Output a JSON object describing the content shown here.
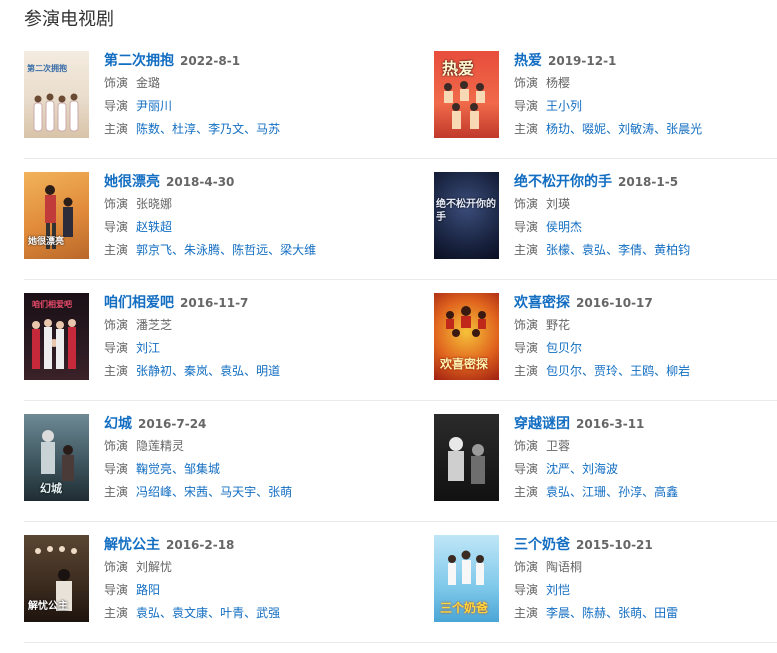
{
  "page_title": "参演电视剧",
  "labels": {
    "role": "饰演",
    "director": "导演",
    "cast": "主演"
  },
  "shows": [
    {
      "title": "第二次拥抱",
      "date": "2022-8-1",
      "role": "金璐",
      "director": "尹丽川",
      "cast": [
        "陈数",
        "杜淳",
        "李乃文",
        "马苏"
      ],
      "poster_text": "第二次拥抱"
    },
    {
      "title": "热爱",
      "date": "2019-12-1",
      "role": "杨樱",
      "director": "王小列",
      "cast": [
        "杨玏",
        "啜妮",
        "刘敏涛",
        "张晨光"
      ],
      "poster_text": "热爱"
    },
    {
      "title": "她很漂亮",
      "date": "2018-4-30",
      "role": "张晓娜",
      "director": "赵轶超",
      "cast": [
        "郭京飞",
        "朱泳腾",
        "陈哲远",
        "梁大维"
      ],
      "poster_text": "她很漂亮"
    },
    {
      "title": "绝不松开你的手",
      "date": "2018-1-5",
      "role": "刘瑛",
      "director": "侯明杰",
      "cast": [
        "张檬",
        "袁弘",
        "李倩",
        "黄柏钧"
      ],
      "poster_text": "绝不松开你的手"
    },
    {
      "title": "咱们相爱吧",
      "date": "2016-11-7",
      "role": "潘芝芝",
      "director": "刘江",
      "cast": [
        "张静初",
        "秦岚",
        "袁弘",
        "明道"
      ],
      "poster_text": "咱们相爱吧"
    },
    {
      "title": "欢喜密探",
      "date": "2016-10-17",
      "role": "野花",
      "director": "包贝尔",
      "cast": [
        "包贝尔",
        "贾玲",
        "王鸥",
        "柳岩"
      ],
      "poster_text": "欢喜密探"
    },
    {
      "title": "幻城",
      "date": "2016-7-24",
      "role": "隐莲精灵",
      "director": "鞠觉亮、邹集城",
      "cast": [
        "冯绍峰",
        "宋茜",
        "马天宇",
        "张萌"
      ],
      "poster_text": "幻城"
    },
    {
      "title": "穿越谜团",
      "date": "2016-3-11",
      "role": "卫蓉",
      "director": "沈严、刘海波",
      "cast": [
        "袁弘",
        "江珊",
        "孙淳",
        "高鑫"
      ],
      "poster_text": ""
    },
    {
      "title": "解忧公主",
      "date": "2016-2-18",
      "role": "刘解忧",
      "director": "路阳",
      "cast": [
        "袁弘",
        "袁文康",
        "叶青",
        "武强"
      ],
      "poster_text": "解忧公主"
    },
    {
      "title": "三个奶爸",
      "date": "2015-10-21",
      "role": "陶语桐",
      "director": "刘恺",
      "cast": [
        "李晨",
        "陈赫",
        "张萌",
        "田雷"
      ],
      "poster_text": "三个奶爸"
    }
  ],
  "colors": {
    "link": "#136ec2",
    "muted": "#666666",
    "divider": "#eaeaea"
  }
}
